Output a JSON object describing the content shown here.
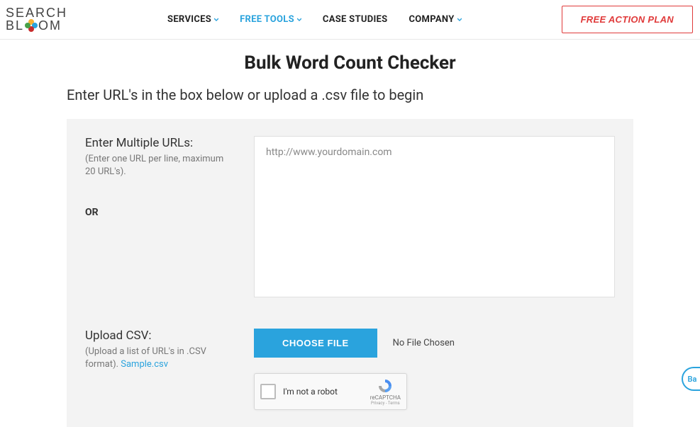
{
  "header": {
    "logo_line1": "SEARCH",
    "logo_line2_left": "BL",
    "logo_line2_right": "OM",
    "nav": [
      {
        "label": "SERVICES",
        "active": false,
        "hasDropdown": true
      },
      {
        "label": "FREE TOOLS",
        "active": true,
        "hasDropdown": true
      },
      {
        "label": "CASE STUDIES",
        "active": false,
        "hasDropdown": false
      },
      {
        "label": "COMPANY",
        "active": false,
        "hasDropdown": true
      }
    ],
    "cta": "FREE ACTION PLAN"
  },
  "page": {
    "title": "Bulk Word Count Checker",
    "subtitle": "Enter URL's in the box below or upload a .csv file to begin"
  },
  "form": {
    "urls_label": "Enter Multiple URLs:",
    "urls_hint": "(Enter one URL per line, maximum 20 URL's).",
    "urls_placeholder": "http://www.yourdomain.com",
    "or": "OR",
    "upload_label": "Upload CSV:",
    "upload_hint_prefix": "(Upload a list of URL's in .CSV format). ",
    "upload_sample_link": "Sample.csv",
    "choose_file": "CHOOSE FILE",
    "file_status": "No File Chosen",
    "recaptcha_text": "I'm not a robot",
    "recaptcha_brand": "reCAPTCHA",
    "recaptcha_sub": "Privacy - Terms"
  },
  "help_bubble": "Ba"
}
